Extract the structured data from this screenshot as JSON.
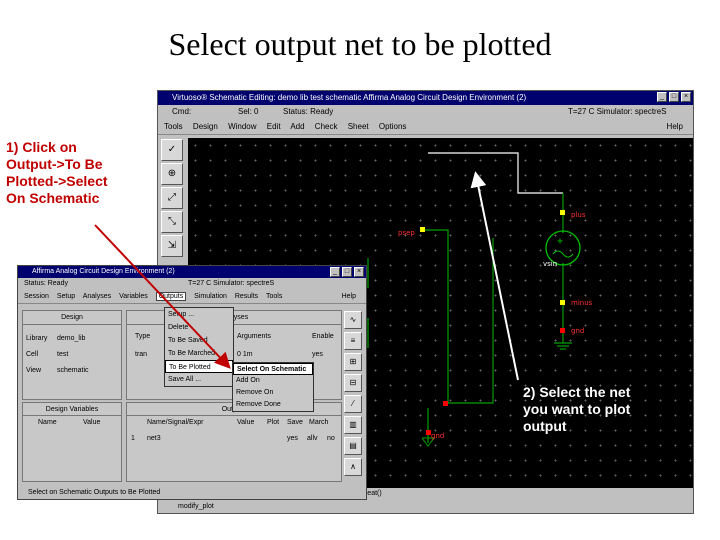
{
  "slide": {
    "title": "Select output net to be plotted"
  },
  "schematic": {
    "title": "Virtuoso® Schematic Editing: demo lib test schematic        Affirma Analog Circuit Design Environment (2)",
    "status": {
      "cmd": "Cmd:",
      "sel": "Sel: 0",
      "status": "Status: Ready",
      "temp": "T=27 C  Simulator: spectreS"
    },
    "menus": [
      "Tools",
      "Design",
      "Window",
      "Edit",
      "Add",
      "Check",
      "Sheet",
      "Options"
    ],
    "help": "Help",
    "labels": {
      "plus": "plus",
      "psep": "psep",
      "source": "vsin",
      "minus": "minus",
      "gnd": "gnd",
      "gnd2": "gnd"
    },
    "cmdline": "mouse L: schSingleSelectPt()        M: schHiMousePopUp()        R: schHiRepeat()",
    "prompt": "modify_plot"
  },
  "ade": {
    "title": "Affirma Analog Circuit Design Environment (2)",
    "status": "Status: Ready",
    "temp": "T=27 C  Simulator: spectreS",
    "menus": [
      "Session",
      "Setup",
      "Analyses",
      "Variables",
      "Outputs",
      "Simulation",
      "Results",
      "Tools"
    ],
    "active_menu": "Outputs",
    "help": "Help",
    "design": {
      "header": "Design",
      "library_label": "Library",
      "library": "demo_lib",
      "cell_label": "Cell",
      "cell": "test",
      "view_label": "View",
      "view": "schematic"
    },
    "analyses_header": "Analyses",
    "analyses_cols": [
      "Type",
      "Arguments",
      "Enable"
    ],
    "analyses_rows": [
      [
        "tran",
        "0  1m",
        "yes"
      ]
    ],
    "design_vars": {
      "header": "Design Variables",
      "cols": [
        "Name",
        "Value"
      ]
    },
    "outputs": {
      "header": "Outputs",
      "cols": [
        "Name/Signal/Expr",
        "Value",
        "Plot",
        "Save",
        "March"
      ],
      "rows": [
        [
          "1",
          "net3",
          "",
          "yes",
          "allv",
          "no"
        ]
      ]
    },
    "status_bar": "Select on Schematic Outputs to Be Plotted"
  },
  "outputs_menu": {
    "items": [
      "Setup ...",
      "Delete",
      "To Be Saved",
      "To Be Marched",
      "To Be Plotted",
      "Save All ..."
    ],
    "selected": "To Be Plotted"
  },
  "submenu": {
    "items": [
      "Select On Schematic",
      "Add On",
      "Remove On",
      "Remove Done"
    ],
    "active": "Select On Schematic"
  },
  "annotations": {
    "step1": [
      "1) Click on",
      "Output->To Be",
      "Plotted->Select",
      "On Schematic"
    ],
    "step2": [
      "2) Select the net",
      "you want to plot",
      "output"
    ]
  },
  "colors": {
    "annotation_red": "#c00000",
    "window_title": "#00006e",
    "wire": "#00a000",
    "pin": "#ffff00",
    "source": "#00c000",
    "marker": "#ff0000"
  }
}
